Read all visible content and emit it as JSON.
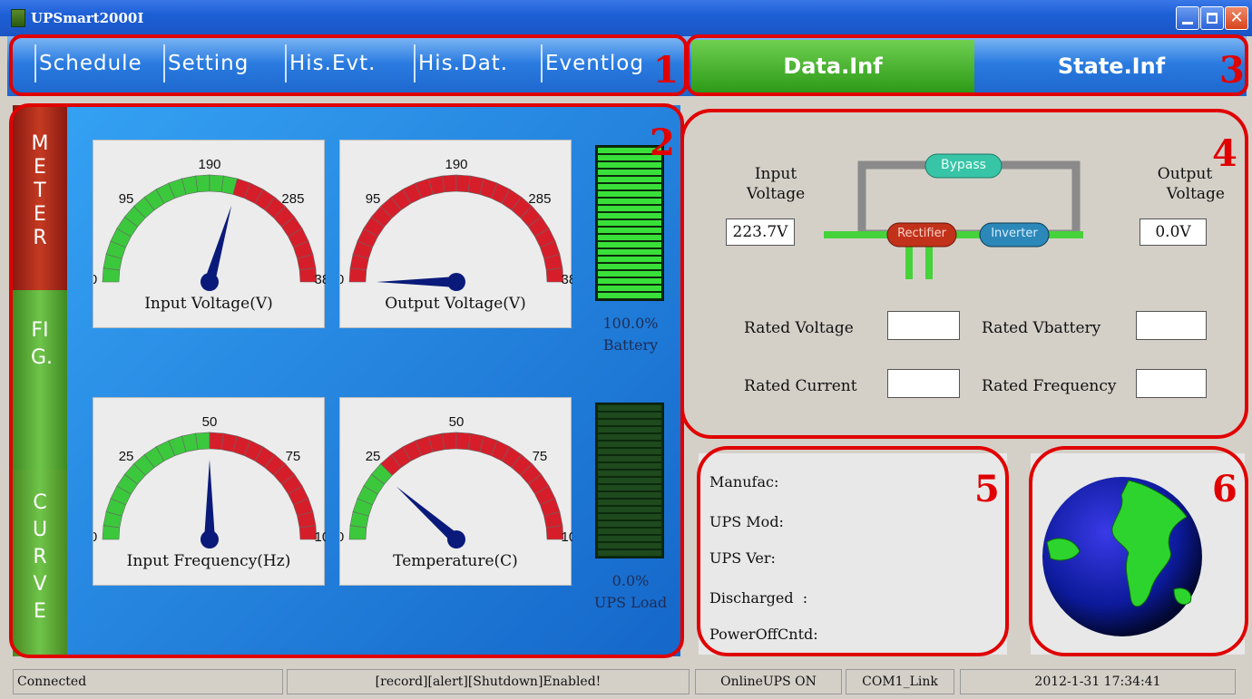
{
  "window": {
    "title": "UPSmart2000I",
    "colors": {
      "title_bar": "#1d5fd6",
      "tab_active": "#2d9a18",
      "panel": "#1567c9",
      "annotation": "#e00000"
    }
  },
  "tabs": {
    "left": [
      "Schedule",
      "Setting",
      "His.Evt.",
      "His.Dat.",
      "Eventlog"
    ],
    "data": "Data.Inf",
    "state": "State.Inf"
  },
  "side_tabs": {
    "meter": "METER",
    "fig": "FIG.",
    "curve": "CURVE"
  },
  "gauges": [
    {
      "label": "Input Voltage(V)",
      "ticks": [
        "0",
        "95",
        "190",
        "285",
        "380"
      ],
      "min": 0,
      "max": 380,
      "value": 223.7
    },
    {
      "label": "Output Voltage(V)",
      "ticks": [
        "0",
        "95",
        "190",
        "285",
        "380"
      ],
      "min": 0,
      "max": 380,
      "value": 0
    },
    {
      "label": "Input Frequency(Hz)",
      "ticks": [
        "0",
        "25",
        "50",
        "75",
        "100"
      ],
      "min": 0,
      "max": 100,
      "value": 50
    },
    {
      "label": "Temperature(C)",
      "ticks": [
        "0",
        "25",
        "50",
        "75",
        "100"
      ],
      "min": 0,
      "max": 100,
      "value": 23
    }
  ],
  "battery": {
    "value": "100.0%",
    "label": "Battery",
    "fill_fraction": 1.0
  },
  "ups_load": {
    "value": "0.0%",
    "label": "UPS Load",
    "fill_fraction": 0.0
  },
  "data_inf": {
    "input_voltage_label_1": "Input",
    "input_voltage_label_2": "Voltage",
    "input_voltage_value": "223.7V",
    "output_voltage_label_1": "Output",
    "output_voltage_label_2": "Voltage",
    "output_voltage_value": "0.0V",
    "bypass": "Bypass",
    "rectifier": "Rectifier",
    "inverter": "Inverter",
    "rated_voltage": "Rated Voltage",
    "rated_vbattery": "Rated Vbattery",
    "rated_current": "Rated Current",
    "rated_frequency": "Rated Frequency"
  },
  "info": {
    "manufac": "Manufac:",
    "ups_mod": "UPS Mod:",
    "ups_ver": "UPS Ver:",
    "discharged": "Discharged  :",
    "poweroff": "PowerOffCntd:"
  },
  "annotations": [
    "1",
    "2",
    "3",
    "4",
    "5",
    "6"
  ],
  "status": {
    "connection": "Connected",
    "flags": "[record][alert][Shutdown]Enabled!",
    "ups_state": "OnlineUPS ON",
    "port": "COM1_Link",
    "datetime": "2012-1-31 17:34:41"
  }
}
